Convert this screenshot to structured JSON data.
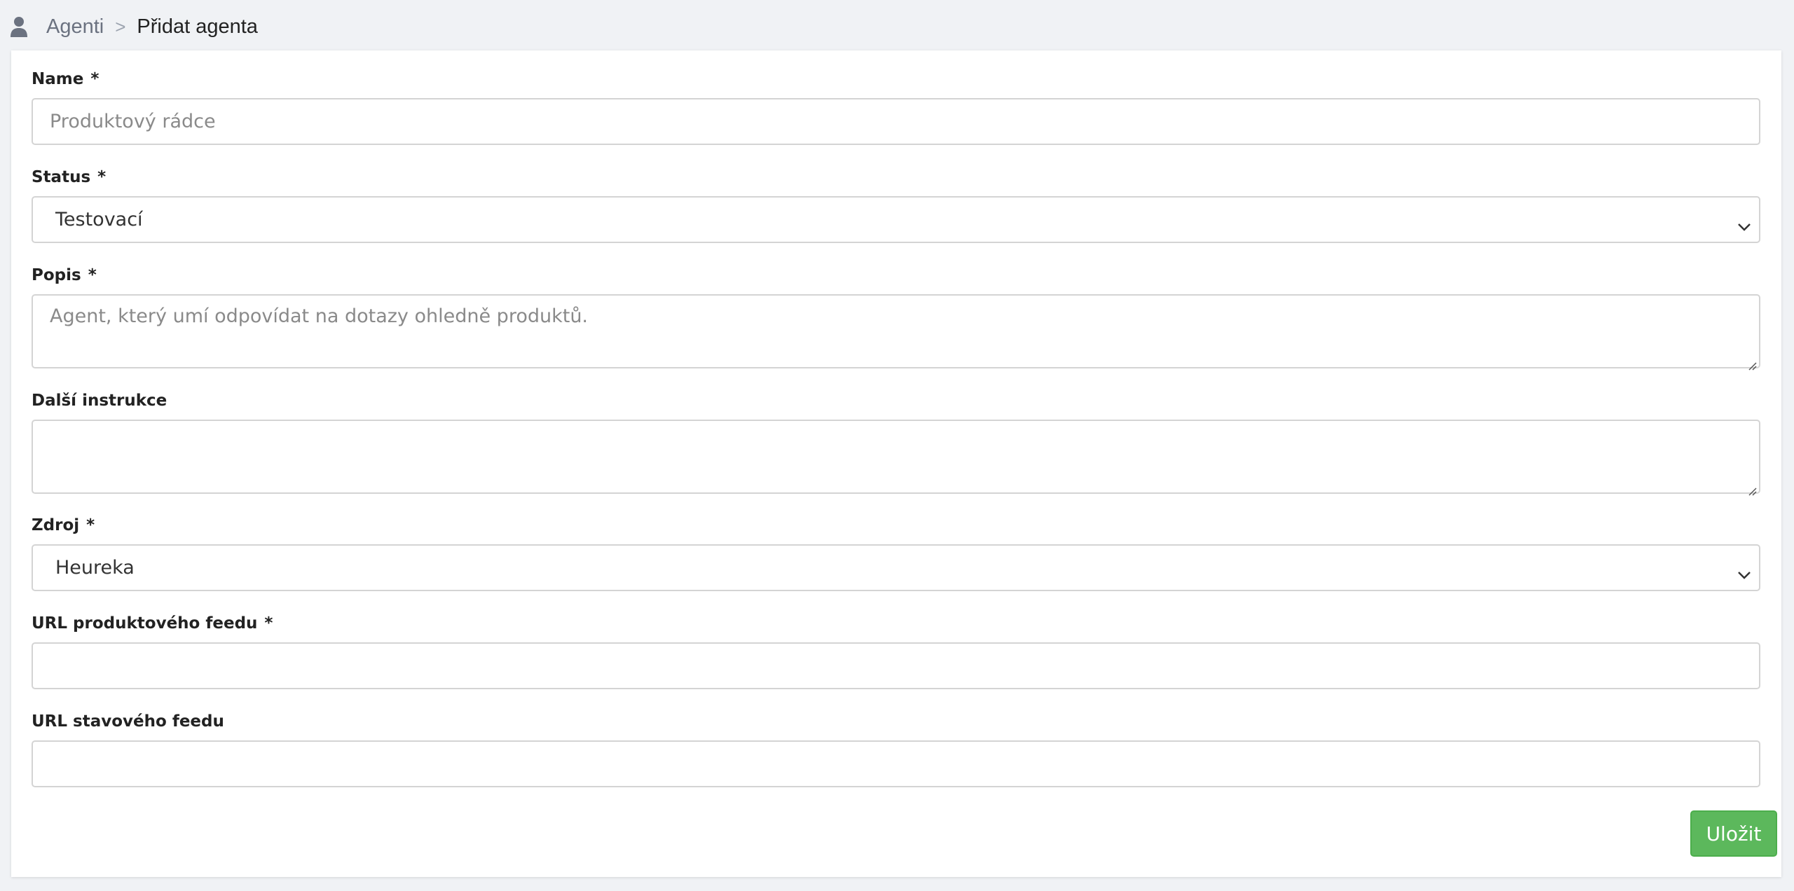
{
  "breadcrumb": {
    "icon": "user-icon",
    "parent": "Agenti",
    "separator": ">",
    "current": "Přidat agenta"
  },
  "form": {
    "required_mark": "*",
    "name": {
      "label": "Name",
      "value": "",
      "placeholder": "Produktový rádce"
    },
    "status": {
      "label": "Status",
      "selected": "Testovací"
    },
    "popis": {
      "label": "Popis",
      "value": "",
      "placeholder": "Agent, který umí odpovídat na dotazy ohledně produktů."
    },
    "dalsi_instrukce": {
      "label": "Další instrukce",
      "value": ""
    },
    "zdroj": {
      "label": "Zdroj",
      "selected": "Heureka"
    },
    "url_produktoveho_feedu": {
      "label": "URL produktového feedu",
      "value": ""
    },
    "url_stavoveho_feedu": {
      "label": "URL stavového feedu",
      "value": ""
    },
    "save_label": "Uložit"
  },
  "colors": {
    "background": "#f0f2f5",
    "card": "#ffffff",
    "input_border": "#d4d4d4",
    "save_button": "#5cb85c",
    "placeholder": "#8a8a8a"
  }
}
